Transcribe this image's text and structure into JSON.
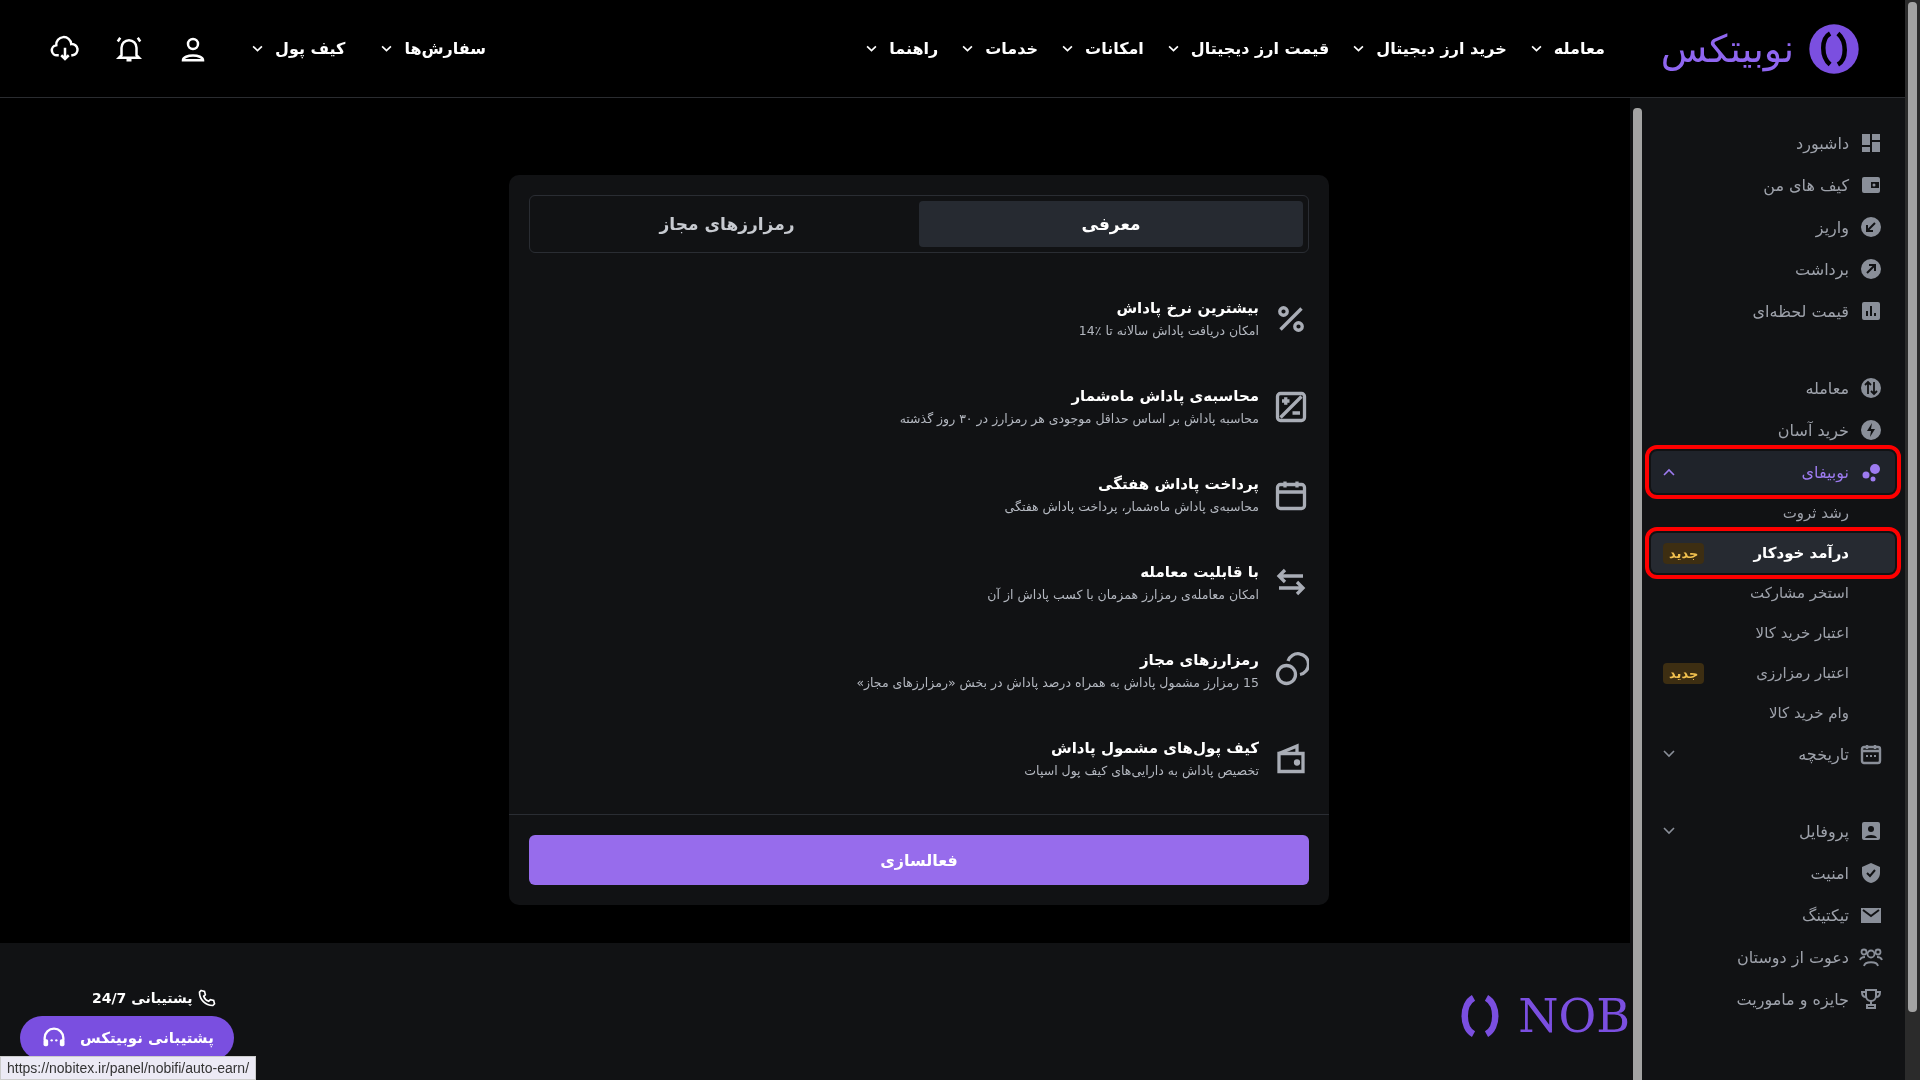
{
  "header": {
    "logo": "نوبیتکس",
    "nav": [
      "معامله",
      "خرید ارز دیجیتال",
      "قیمت ارز دیجیتال",
      "امکانات",
      "خدمات",
      "راهنما"
    ],
    "user_menu": [
      "سفارش‌ها",
      "کیف پول"
    ]
  },
  "card": {
    "tabs": [
      {
        "label": "معرفی",
        "selected": true
      },
      {
        "label": "رمزارزهای مجاز",
        "selected": false
      }
    ],
    "features": [
      {
        "title": "بیشترین نرخ پاداش",
        "description": "امکان دریافت پاداش سالانه تا ٪14"
      },
      {
        "title": "محاسبه‌ی پاداش ماه‌شمار",
        "description": "محاسبه پاداش بر اساس حداقل موجودی هر رمزارز در ۳۰ روز گذشته"
      },
      {
        "title": "پرداخت پاداش هفتگی",
        "description": "محاسبه‌ی پاداش ماه‌شمار، پرداخت پاداش هفتگی"
      },
      {
        "title": "با قابلیت معامله",
        "description": "امکان معامله‌ی رمزارز همزمان با کسب پاداش از آن"
      },
      {
        "title": "رمزارزهای مجاز",
        "description": "15 رمزارز مشمول پاداش به همراه درصد پاداش در بخش «رمزارزهای مجاز»"
      },
      {
        "title": "کیف پول‌های مشمول پاداش",
        "description": "تخصیص پاداش به دارایی‌های کیف پول اسپات"
      }
    ],
    "button": "فعالسازی"
  },
  "sidebar": {
    "groups": [
      {
        "items": [
          {
            "label": "داشبورد"
          },
          {
            "label": "کیف های من"
          },
          {
            "label": "واریز"
          },
          {
            "label": "برداشت"
          },
          {
            "label": "قیمت لحظه‌ای"
          }
        ]
      },
      {
        "items": [
          {
            "label": "معامله"
          },
          {
            "label": "خرید آسان"
          },
          {
            "label": "نوبیفای",
            "selected": true,
            "expanded": true,
            "highlighted": true,
            "children": [
              {
                "label": "رشد ثروت",
                "selected": false
              },
              {
                "label": "درآمد خودکار",
                "selected": true,
                "badge": "جدید",
                "highlighted": true
              },
              {
                "label": "استخر مشارکت",
                "selected": false
              },
              {
                "label": "اعتبار خرید کالا",
                "selected": false
              },
              {
                "label": "اعتبار رمزارزی",
                "selected": false,
                "badge": "جدید"
              },
              {
                "label": "وام خرید کالا",
                "selected": false
              }
            ]
          },
          {
            "label": "تاریخچه",
            "expanded": false
          }
        ]
      },
      {
        "items": [
          {
            "label": "پروفایل",
            "expanded": false
          },
          {
            "label": "امنیت"
          },
          {
            "label": "تیکتینگ"
          },
          {
            "label": "دعوت از دوستان"
          },
          {
            "label": "جایزه و ماموریت"
          }
        ]
      }
    ]
  },
  "footer": {
    "logo_text": "NOB",
    "support_label": "پشتیبانی 24/7",
    "chat_button": "پشتیبانی نوبیتکس",
    "status_url": "https://nobitex.ir/panel/nobifi/auto-earn/"
  }
}
